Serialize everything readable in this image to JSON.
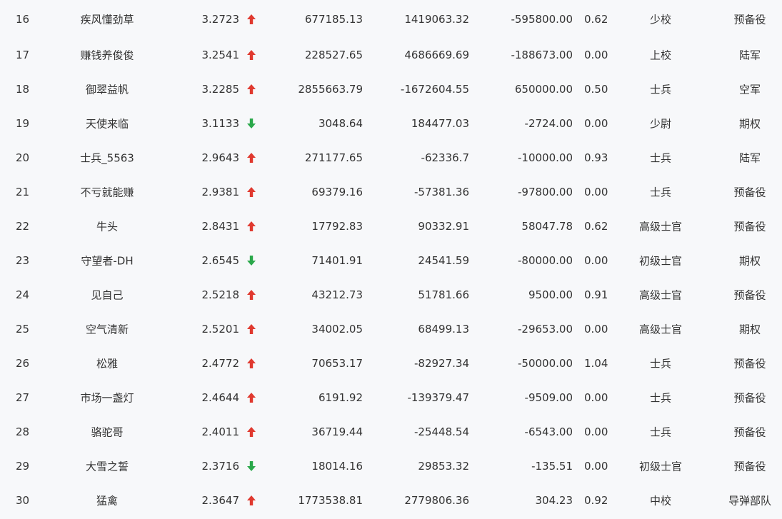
{
  "colors": {
    "up": "#e0392f",
    "down": "#2aa84a",
    "text": "#333333",
    "background": "#f7f8fa"
  },
  "rows": [
    {
      "rank": "16",
      "name": "疾风懂劲草",
      "score": "3.2723",
      "trend": "up",
      "v1": "677185.13",
      "v2": "1419063.32",
      "v3": "-595800.00",
      "ratio": "0.62",
      "military_rank": "少校",
      "unit": "预备役"
    },
    {
      "rank": "17",
      "name": "赚钱养俊俊",
      "score": "3.2541",
      "trend": "up",
      "v1": "228527.65",
      "v2": "4686669.69",
      "v3": "-188673.00",
      "ratio": "0.00",
      "military_rank": "上校",
      "unit": "陆军"
    },
    {
      "rank": "18",
      "name": "御翠益帆",
      "score": "3.2285",
      "trend": "up",
      "v1": "2855663.79",
      "v2": "-1672604.55",
      "v3": "650000.00",
      "ratio": "0.50",
      "military_rank": "士兵",
      "unit": "空军"
    },
    {
      "rank": "19",
      "name": "天使来临",
      "score": "3.1133",
      "trend": "down",
      "v1": "3048.64",
      "v2": "184477.03",
      "v3": "-2724.00",
      "ratio": "0.00",
      "military_rank": "少尉",
      "unit": "期权"
    },
    {
      "rank": "20",
      "name": "士兵_5563",
      "score": "2.9643",
      "trend": "up",
      "v1": "271177.65",
      "v2": "-62336.7",
      "v3": "-10000.00",
      "ratio": "0.93",
      "military_rank": "士兵",
      "unit": "陆军"
    },
    {
      "rank": "21",
      "name": "不亏就能赚",
      "score": "2.9381",
      "trend": "up",
      "v1": "69379.16",
      "v2": "-57381.36",
      "v3": "-97800.00",
      "ratio": "0.00",
      "military_rank": "士兵",
      "unit": "预备役"
    },
    {
      "rank": "22",
      "name": "牛头",
      "score": "2.8431",
      "trend": "up",
      "v1": "17792.83",
      "v2": "90332.91",
      "v3": "58047.78",
      "ratio": "0.62",
      "military_rank": "高级士官",
      "unit": "预备役"
    },
    {
      "rank": "23",
      "name": "守望者-DH",
      "score": "2.6545",
      "trend": "down",
      "v1": "71401.91",
      "v2": "24541.59",
      "v3": "-80000.00",
      "ratio": "0.00",
      "military_rank": "初级士官",
      "unit": "期权"
    },
    {
      "rank": "24",
      "name": "见自己",
      "score": "2.5218",
      "trend": "up",
      "v1": "43212.73",
      "v2": "51781.66",
      "v3": "9500.00",
      "ratio": "0.91",
      "military_rank": "高级士官",
      "unit": "预备役"
    },
    {
      "rank": "25",
      "name": "空气清新",
      "score": "2.5201",
      "trend": "up",
      "v1": "34002.05",
      "v2": "68499.13",
      "v3": "-29653.00",
      "ratio": "0.00",
      "military_rank": "高级士官",
      "unit": "期权"
    },
    {
      "rank": "26",
      "name": "松雅",
      "score": "2.4772",
      "trend": "up",
      "v1": "70653.17",
      "v2": "-82927.34",
      "v3": "-50000.00",
      "ratio": "1.04",
      "military_rank": "士兵",
      "unit": "预备役"
    },
    {
      "rank": "27",
      "name": "市场一盏灯",
      "score": "2.4644",
      "trend": "up",
      "v1": "6191.92",
      "v2": "-139379.47",
      "v3": "-9509.00",
      "ratio": "0.00",
      "military_rank": "士兵",
      "unit": "预备役"
    },
    {
      "rank": "28",
      "name": "骆驼哥",
      "score": "2.4011",
      "trend": "up",
      "v1": "36719.44",
      "v2": "-25448.54",
      "v3": "-6543.00",
      "ratio": "0.00",
      "military_rank": "士兵",
      "unit": "预备役"
    },
    {
      "rank": "29",
      "name": "大雪之誓",
      "score": "2.3716",
      "trend": "down",
      "v1": "18014.16",
      "v2": "29853.32",
      "v3": "-135.51",
      "ratio": "0.00",
      "military_rank": "初级士官",
      "unit": "预备役"
    },
    {
      "rank": "30",
      "name": "猛禽",
      "score": "2.3647",
      "trend": "up",
      "v1": "1773538.81",
      "v2": "2779806.36",
      "v3": "304.23",
      "ratio": "0.92",
      "military_rank": "中校",
      "unit": "导弹部队"
    }
  ]
}
